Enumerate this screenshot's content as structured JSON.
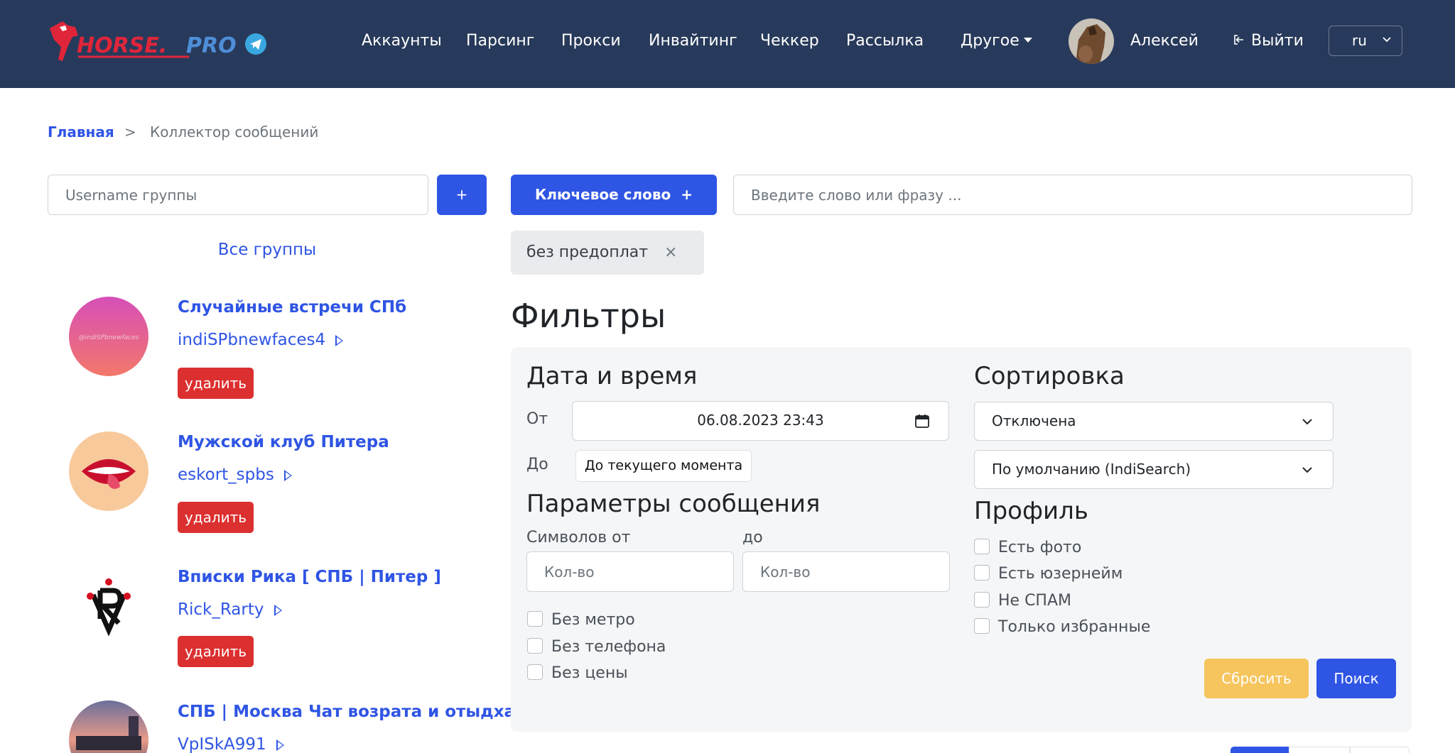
{
  "navbar": {
    "logo_text": "HORSE.PRO",
    "links": [
      "Аккаунты",
      "Парсинг",
      "Прокси",
      "Инвайтинг",
      "Чеккер",
      "Рассылка",
      "Другое"
    ],
    "user_name": "Алексей",
    "logout_label": "Выйти",
    "language": "ru"
  },
  "breadcrumb": {
    "home": "Главная",
    "separator": ">",
    "current": "Коллектор сообщений"
  },
  "group_search": {
    "placeholder": "Username группы",
    "add_label": "+",
    "all_groups_label": "Все группы"
  },
  "groups": [
    {
      "title": "Случайные встречи СПб",
      "username": "indiSPbnewfaces4",
      "avatar_text": "@indiSPbnewfaces",
      "delete_label": "удалить"
    },
    {
      "title": "Мужской клуб Питера",
      "username": "eskort_spbs",
      "delete_label": "удалить"
    },
    {
      "title": "Вписки Рика [ СПБ | Питер ]",
      "username": "Rick_Rarty",
      "delete_label": "удалить"
    },
    {
      "title": "СПБ | Москва Чат возрата и отыдха",
      "username": "VpISkA991"
    }
  ],
  "keyword": {
    "button_label": "Ключевое слово  +",
    "placeholder": "Введите слово или фразу ...",
    "tags": [
      {
        "text": "без предоплат",
        "remove": "×"
      }
    ]
  },
  "filters": {
    "title": "Фильтры",
    "datetime": {
      "title": "Дата и время",
      "from_label": "От",
      "from_value": "06.08.2023 23:43",
      "to_label": "До",
      "to_button": "До текущего момента"
    },
    "message_params": {
      "title": "Параметры сообщения",
      "chars_from_label": "Символов от",
      "chars_to_label": "до",
      "qty_placeholder": "Кол-во",
      "checks": [
        "Без метро",
        "Без телефона",
        "Без цены"
      ]
    },
    "sorting": {
      "title": "Сортировка",
      "mode": "Отключена",
      "order": "По умолчанию (IndiSearch)"
    },
    "profile": {
      "title": "Профиль",
      "checks": [
        "Есть фото",
        "Есть юзернейм",
        "Не СПАМ",
        "Только избранные"
      ]
    },
    "reset_label": "Сбросить",
    "search_label": "Поиск"
  },
  "colors": {
    "navbar_bg": "#283a5b",
    "accent_blue": "#2f55e4",
    "danger_red": "#dc2f2f",
    "warning_yellow": "#f6c55d",
    "panel_bg": "#f5f6f8"
  },
  "icons": [
    "telegram-icon",
    "logout-icon",
    "chevron-down-icon",
    "calendar-icon",
    "play-icon"
  ]
}
